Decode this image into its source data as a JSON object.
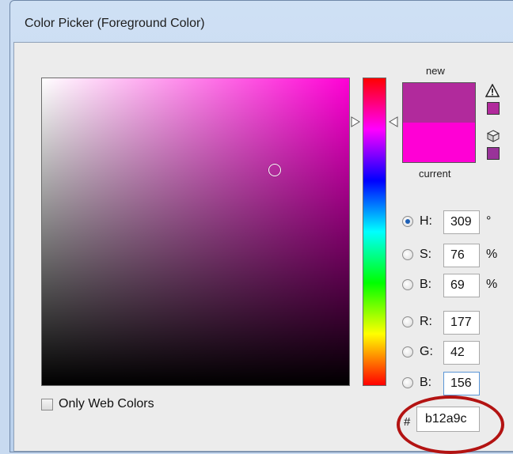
{
  "window": {
    "title": "Color Picker (Foreground Color)"
  },
  "swatches": {
    "new_label": "new",
    "current_label": "current",
    "new_color": "#b12a9c",
    "current_color": "#ff00d5",
    "websafe_color": "#993399"
  },
  "field": {
    "hue_color": "#ff00d5"
  },
  "fields": [
    {
      "label": "H:",
      "value": "309",
      "unit": "°",
      "checked": true
    },
    {
      "label": "S:",
      "value": "76",
      "unit": "%",
      "checked": false
    },
    {
      "label": "B:",
      "value": "69",
      "unit": "%",
      "checked": false
    },
    {
      "label": "R:",
      "value": "177",
      "unit": "",
      "checked": false
    },
    {
      "label": "G:",
      "value": "42",
      "unit": "",
      "checked": false
    },
    {
      "label": "B:",
      "value": "156",
      "unit": "",
      "checked": false
    }
  ],
  "only_web_colors": {
    "label": "Only Web Colors",
    "checked": false
  },
  "hex": {
    "prefix": "#",
    "value": "b12a9c"
  },
  "annotation": {
    "color": "#b31312"
  }
}
